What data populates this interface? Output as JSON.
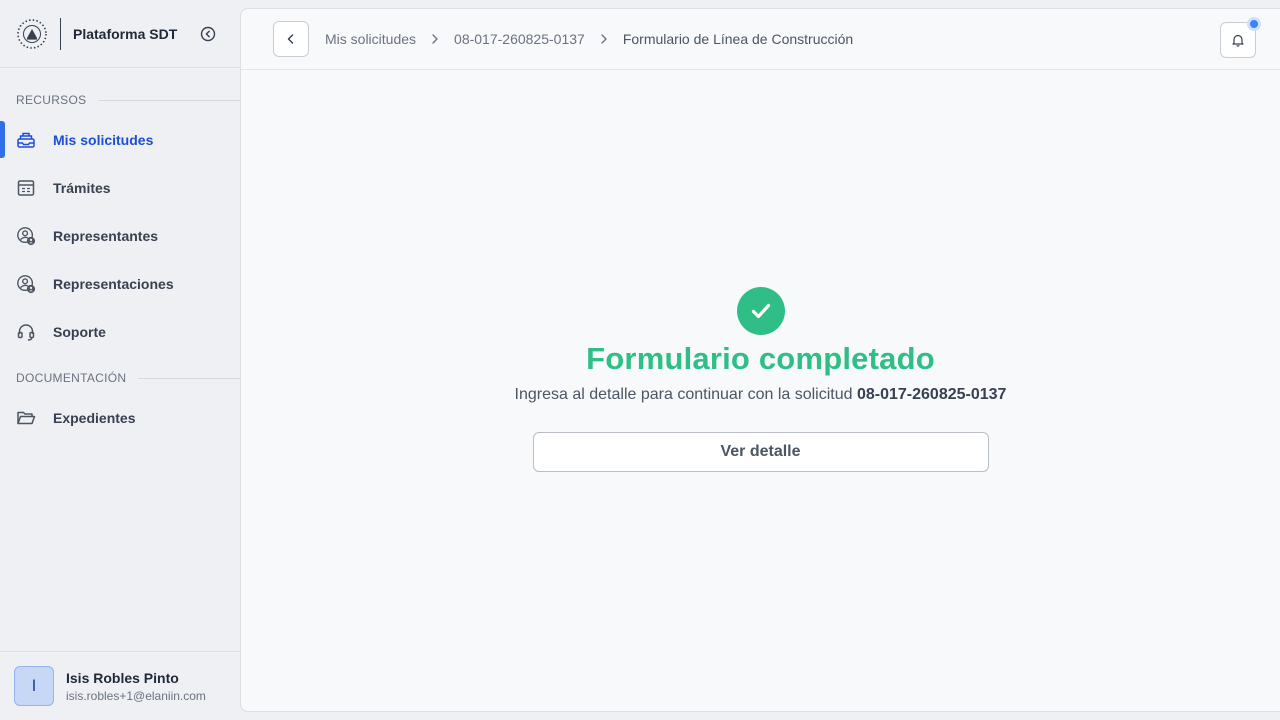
{
  "brand": {
    "title": "Plataforma SDT"
  },
  "sidebar": {
    "section_resources": "RECURSOS",
    "section_docs": "DOCUMENTACIÓN",
    "items": [
      {
        "label": "Mis solicitudes",
        "icon": "inbox-stack-icon",
        "active": true
      },
      {
        "label": "Trámites",
        "icon": "form-icon"
      },
      {
        "label": "Representantes",
        "icon": "user-circle-icon"
      },
      {
        "label": "Representaciones",
        "icon": "user-circle-icon"
      },
      {
        "label": "Soporte",
        "icon": "headset-icon"
      }
    ],
    "doc_items": [
      {
        "label": "Expedientes",
        "icon": "folder-open-icon"
      }
    ]
  },
  "user": {
    "initial": "I",
    "name": "Isis Robles Pinto",
    "email": "isis.robles+1@elaniin.com"
  },
  "breadcrumb": {
    "items": [
      "Mis solicitudes",
      "08-017-260825-0137",
      "Formulario de Línea de Construcción"
    ]
  },
  "result": {
    "title": "Formulario completado",
    "message": "Ingresa al detalle para continuar con la solicitud",
    "request_id": "08-017-260825-0137",
    "button_label": "Ver detalle"
  },
  "colors": {
    "accent": "#2f6fe8",
    "success": "#2fbf86"
  }
}
